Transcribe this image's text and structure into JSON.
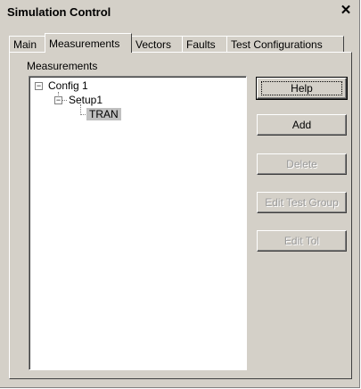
{
  "window": {
    "title": "Simulation Control",
    "close_glyph": "✕"
  },
  "tabs": [
    {
      "label": "Main"
    },
    {
      "label": "Measurements"
    },
    {
      "label": "Vectors"
    },
    {
      "label": "Faults"
    },
    {
      "label": "Test Configurations"
    }
  ],
  "active_tab": "Measurements",
  "panel": {
    "group_label": "Measurements",
    "tree": {
      "root": {
        "label": "Config 1",
        "expander": "−"
      },
      "child": {
        "label": "Setup1",
        "expander": "−"
      },
      "leaf": {
        "label": "TRAN"
      }
    }
  },
  "buttons": {
    "help": "Help",
    "add": "Add",
    "delete": "Delete",
    "edit_test_group": "Edit Test Group",
    "edit_tol": "Edit Tol"
  }
}
